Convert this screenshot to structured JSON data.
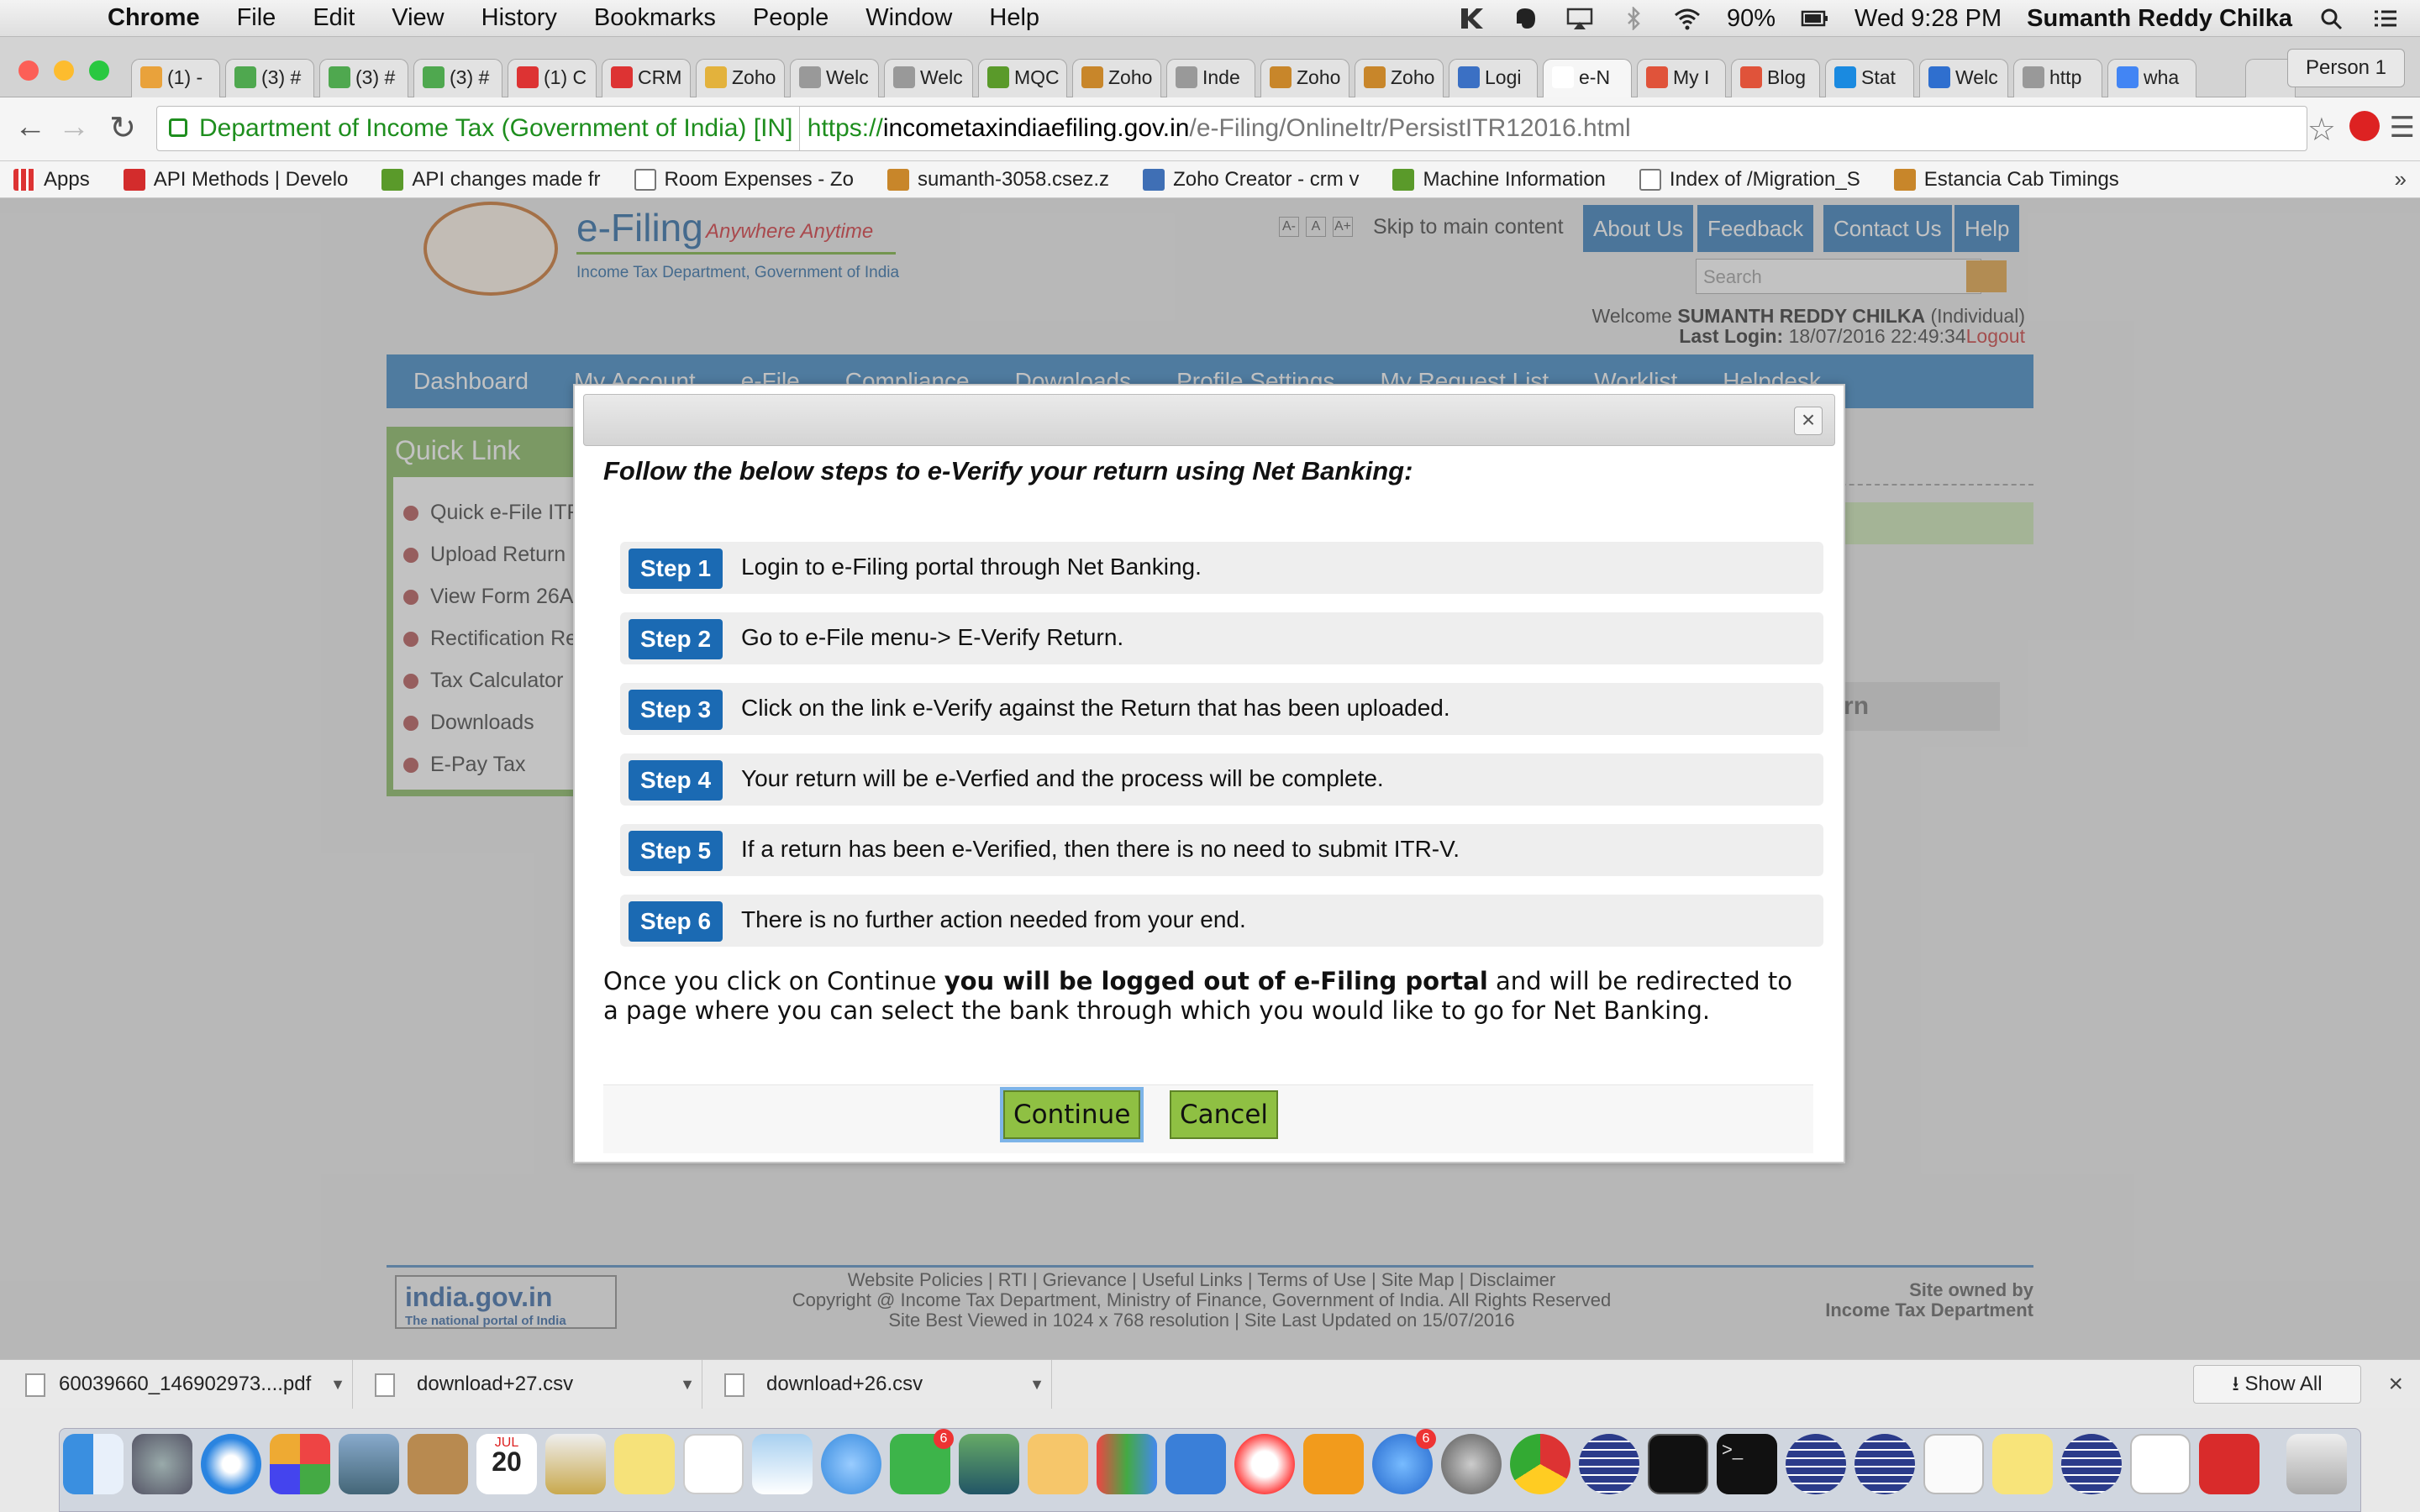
{
  "menubar": {
    "app": "Chrome",
    "items": [
      "File",
      "Edit",
      "View",
      "History",
      "Bookmarks",
      "People",
      "Window",
      "Help"
    ],
    "battery": "90%",
    "clock": "Wed 9:28 PM",
    "user": "Sumanth Reddy Chilka"
  },
  "tabs": [
    {
      "label": "(1) -"
    },
    {
      "label": "(3) #"
    },
    {
      "label": "(3) #"
    },
    {
      "label": "(3) #"
    },
    {
      "label": "(1) C"
    },
    {
      "label": "CRM"
    },
    {
      "label": "Zoho"
    },
    {
      "label": "Welc"
    },
    {
      "label": "Welc"
    },
    {
      "label": "MQC"
    },
    {
      "label": "Zoho"
    },
    {
      "label": "Inde"
    },
    {
      "label": "Zoho"
    },
    {
      "label": "Zoho"
    },
    {
      "label": "Logi"
    },
    {
      "label": "e-N"
    },
    {
      "label": "My I"
    },
    {
      "label": "Blog"
    },
    {
      "label": "Stat"
    },
    {
      "label": "Welc"
    },
    {
      "label": "http"
    },
    {
      "label": "wha"
    }
  ],
  "person_tab": "Person 1",
  "omnibox": {
    "ev_label": "Department of Income Tax (Government of India) [IN]",
    "scheme": "https://",
    "host": "incometaxindiaefiling.gov.in",
    "path": "/e-Filing/OnlineItr/PersistITR12016.html"
  },
  "bookmarks": [
    "Apps",
    "API Methods | Develo",
    "API changes made fr",
    "Room Expenses - Zo",
    "sumanth-3058.csez.z",
    "Zoho Creator - crm v",
    "Machine Information",
    "Index of /Migration_S",
    "Estancia Cab Timings"
  ],
  "site": {
    "title": "e-Filing",
    "tagline": "Anywhere Anytime",
    "subtitle": "Income Tax Department, Government of India",
    "font_controls": [
      "A-",
      "A",
      "A+"
    ],
    "skip_link": "Skip to main content",
    "top_buttons": [
      "About Us",
      "Feedback",
      "Contact Us",
      "Help"
    ],
    "search_placeholder": "Search",
    "welcome_prefix": "Welcome",
    "user_name": "SUMANTH REDDY CHILKA",
    "user_type": "(Individual)",
    "last_login_label": "Last Login:",
    "last_login_value": "18/07/2016 22:49:34",
    "logout": "Logout",
    "nav": [
      "Dashboard",
      "My Account",
      "e-File",
      "Compliance",
      "Downloads",
      "Profile Settings",
      "My Request List",
      "Worklist",
      "Helpdesk"
    ],
    "quick_link_title": "Quick Link",
    "quick_links": [
      "Quick e-File ITR",
      "Upload Return",
      "View Form 26AS",
      "Rectification Request",
      "Tax Calculator",
      "Downloads",
      "E-Pay Tax"
    ],
    "background_button": "ny return",
    "footer_links": "Website Policies  |  RTI  |  Grievance  |  Useful Links  |  Terms of Use  |  Site Map  |  Disclaimer",
    "copyright": "Copyright @ Income Tax Department, Ministry of Finance, Government of India. All Rights Reserved",
    "best_viewed": "Site Best Viewed in 1024 x 768 resolution | Site Last Updated on 15/07/2016",
    "owned_line1": "Site owned by",
    "owned_line2": "Income Tax Department",
    "india_logo": "india.gov.in",
    "india_sub": "The national portal of India"
  },
  "modal": {
    "close": "×",
    "heading": "Follow the below steps to e-Verify your return using Net Banking:",
    "steps": [
      {
        "badge": "Step 1",
        "text": "Login to e-Filing portal through Net Banking."
      },
      {
        "badge": "Step 2",
        "text": "Go to e-File menu-> E-Verify Return."
      },
      {
        "badge": "Step 3",
        "text": "Click on the link e-Verify against the Return that has been uploaded."
      },
      {
        "badge": "Step 4",
        "text": "Your return will be e-Verfied and the process will be complete."
      },
      {
        "badge": "Step 5",
        "text": "If a return has been e-Verified, then there is no need to submit ITR-V."
      },
      {
        "badge": "Step 6",
        "text": "There is no further action needed from your end."
      }
    ],
    "info_prefix": "Once you click on Continue ",
    "info_bold": "you will be logged out of e-Filing portal",
    "info_suffix": " and will be redirected to a page where you can select the bank through which you would like to go for Net Banking.",
    "continue": "Continue",
    "cancel": "Cancel"
  },
  "downloads": {
    "items": [
      "60039660_146902973....pdf",
      "download+27.csv",
      "download+26.csv"
    ],
    "show_all": "Show All",
    "close": "×"
  },
  "dock": {
    "calendar_month": "JUL",
    "calendar_day": "20",
    "badge_a": "6",
    "badge_b": "6"
  },
  "colors": {
    "accent": "#1b6ab3",
    "button_green": "#8fc043",
    "nav_blue": "#2f7fc0",
    "quicklink_green": "#7fb554"
  }
}
